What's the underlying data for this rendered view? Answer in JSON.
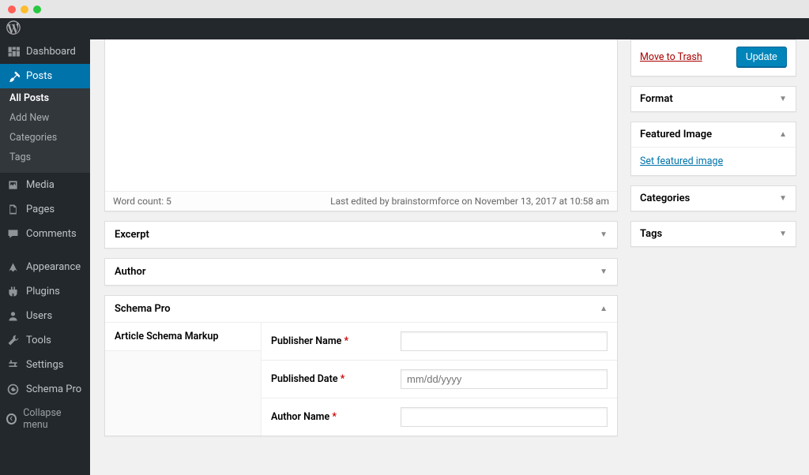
{
  "sidebar": {
    "dashboard": "Dashboard",
    "posts": "Posts",
    "posts_sub": [
      "All Posts",
      "Add New",
      "Categories",
      "Tags"
    ],
    "media": "Media",
    "pages": "Pages",
    "comments": "Comments",
    "appearance": "Appearance",
    "plugins": "Plugins",
    "users": "Users",
    "tools": "Tools",
    "settings": "Settings",
    "schema_pro": "Schema Pro",
    "collapse": "Collapse menu"
  },
  "editor": {
    "word_count_label": "Word count: 5",
    "last_edited": "Last edited by brainstormforce on November 13, 2017 at 10:58 am"
  },
  "panels": {
    "excerpt": "Excerpt",
    "author": "Author",
    "schema_pro": "Schema Pro",
    "schema_markup": "Article Schema Markup",
    "publisher_name": "Publisher Name",
    "published_date": "Published Date",
    "author_name": "Author Name",
    "date_placeholder": "mm/dd/yyyy"
  },
  "sideboxes": {
    "move_to_trash": "Move to Trash",
    "update": "Update",
    "format": "Format",
    "featured_image": "Featured Image",
    "set_featured": "Set featured image",
    "categories": "Categories",
    "tags": "Tags"
  }
}
